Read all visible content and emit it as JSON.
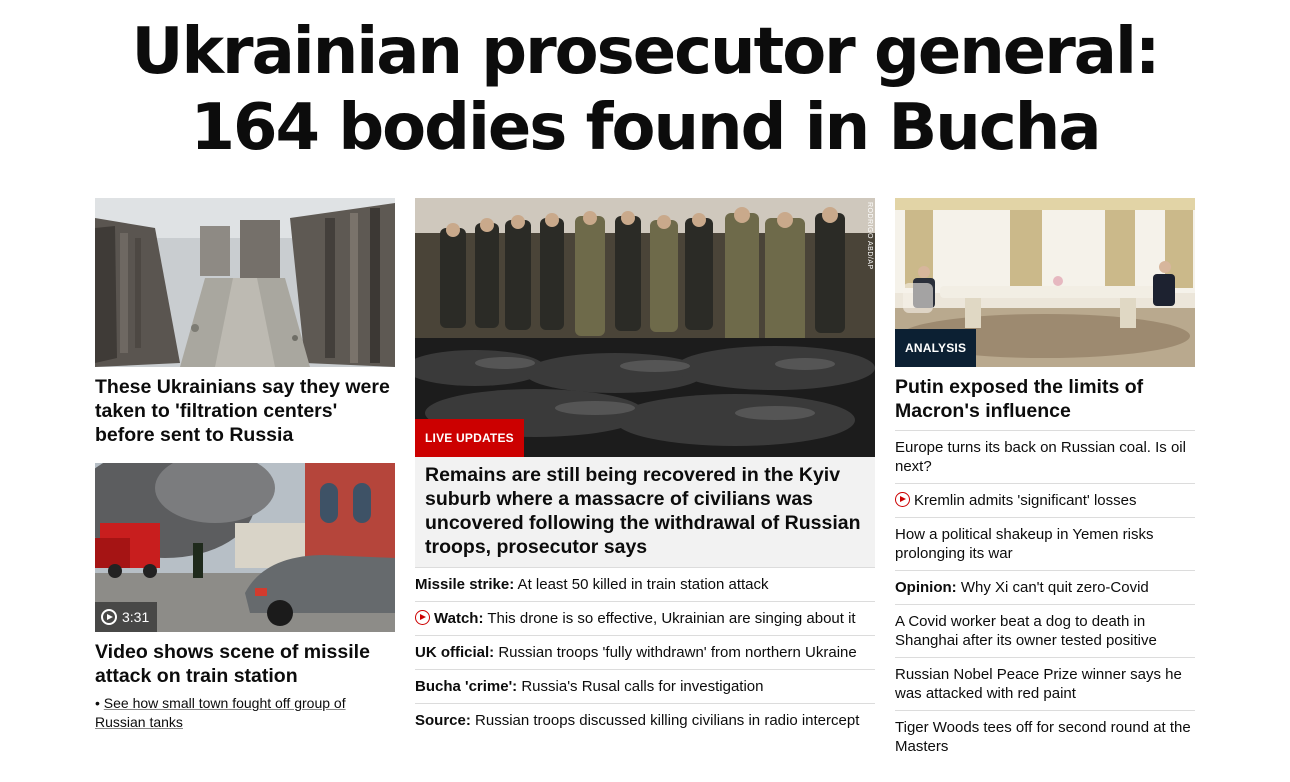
{
  "headline": {
    "line1": "Ukrainian prosecutor general:",
    "line2": "164 bodies found in Bucha"
  },
  "left": {
    "story1": {
      "image_alt": "Destroyed apartment buildings",
      "title": "These Ukrainians say they were taken to 'filtration centers' before sent to Russia"
    },
    "story2": {
      "image_alt": "Fire truck and smoke near train station",
      "video_duration": "3:31",
      "title": "Video shows scene of missile attack on train station",
      "sublink_prefix": "• ",
      "sublink": "See how small town fought off group of Russian tanks"
    }
  },
  "middle": {
    "image_alt": "People standing near body bags in Bucha",
    "photo_credit": "RODRIGO ABD/AP",
    "label": "LIVE UPDATES",
    "title": "Remains are still being recovered in the Kyiv suburb where a massacre of civilians was uncovered following the withdrawal of Russian troops, prosecutor says",
    "items": [
      {
        "bold": "Missile strike:",
        "text": " At least 50 killed in train station attack",
        "video": false
      },
      {
        "bold": "Watch:",
        "text": " This drone is so effective, Ukrainian are singing about it",
        "video": true
      },
      {
        "bold": "UK official:",
        "text": " Russian troops 'fully withdrawn' from northern Ukraine",
        "video": false
      },
      {
        "bold": "Bucha 'crime':",
        "text": " Russia's Rusal calls for investigation",
        "video": false
      },
      {
        "bold": "Source:",
        "text": " Russian troops discussed killing civilians in radio intercept",
        "video": false
      }
    ]
  },
  "right": {
    "image_alt": "Putin and Macron at long table",
    "label": "ANALYSIS",
    "title": "Putin exposed the limits of Macron's influence",
    "items": [
      {
        "bold": "",
        "text": "Europe turns its back on Russian coal. Is oil next?",
        "video": false
      },
      {
        "bold": "",
        "text": "Kremlin admits 'significant' losses",
        "video": true
      },
      {
        "bold": "",
        "text": "How a political shakeup in Yemen risks prolonging its war",
        "video": false
      },
      {
        "bold": "Opinion:",
        "text": " Why Xi can't quit zero-Covid",
        "video": false
      },
      {
        "bold": "",
        "text": "A Covid worker beat a dog to death in Shanghai after its owner tested positive",
        "video": false
      },
      {
        "bold": "",
        "text": "Russian Nobel Peace Prize winner says he was attacked with red paint",
        "video": false
      },
      {
        "bold": "",
        "text": "Tiger Woods tees off for second round at the Masters",
        "video": false
      }
    ]
  },
  "colors": {
    "live_red": "#cc0000",
    "analysis_navy": "#0c2033",
    "text": "#0c0c0c",
    "divider": "#dcdcdc"
  }
}
